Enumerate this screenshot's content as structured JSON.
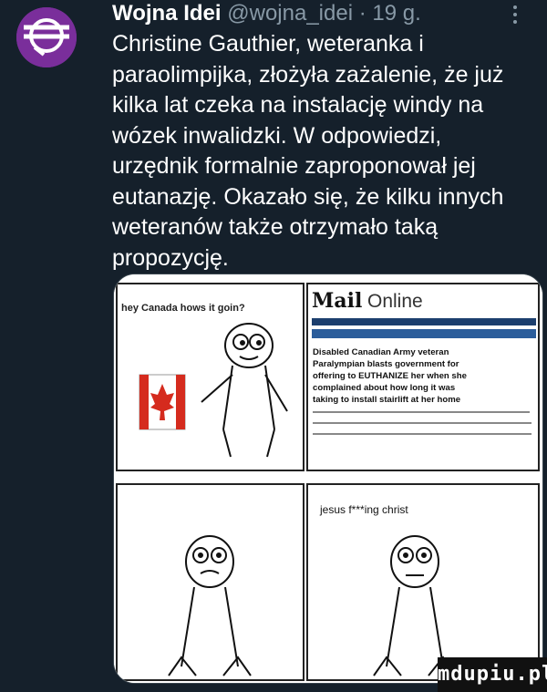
{
  "tweet": {
    "author_name": "Wojna Idei",
    "author_handle": "@wojna_idei",
    "separator": " · ",
    "time": "19 g.",
    "text": "Christine Gauthier, weteranka i paraolimpijka, złożyła zażalenie, że już kilka lat czeka na instalację windy na wózek inwalidzki. W odpowiedzi, urzędnik formalnie zaproponował jej eutanazję. Okazało się, że kilku innych weteranów także otrzymało taką propozycję."
  },
  "comic": {
    "panel1_caption": "hey Canada hows it goin?",
    "logo_mail": "Mail",
    "logo_online": "Online",
    "headline_lines": [
      "Disabled Canadian Army veteran",
      "Paralympian blasts government for",
      "offering to EUTHANIZE her when she",
      "complained about how long it was",
      "taking to install stairlift at her home"
    ],
    "panel4_caption": "jesus f***ing christ"
  },
  "watermark": "mdupiu.pl",
  "colors": {
    "background": "#15202b",
    "secondary_text": "#8899a6",
    "avatar_bg": "#7a2e9b",
    "flag_red": "#d52b1e"
  }
}
